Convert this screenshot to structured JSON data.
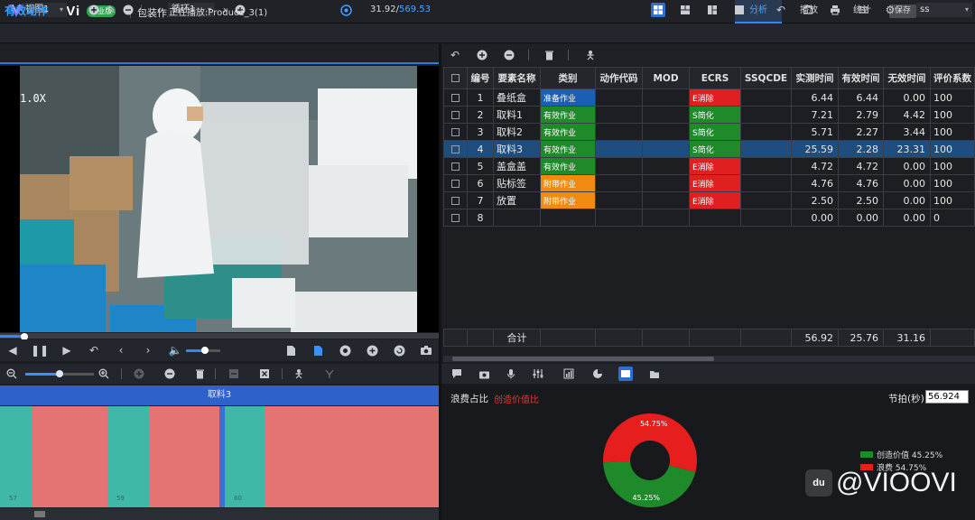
{
  "app": {
    "brand": "ViOOVi",
    "badge": "专业版",
    "project": "包装作业",
    "tabs": [
      "分析",
      "播放",
      "统计"
    ],
    "active_tab": "分析",
    "save_label": "保存"
  },
  "toolbar": {
    "view_select": "视图1",
    "loop_select": "循环1",
    "right_select": "ss"
  },
  "video": {
    "title": "有效动作",
    "status": "正在播放:Produce_3(1)",
    "current_time": "31.92/",
    "total_time": "569.53",
    "zoom": "1.0X",
    "seek_progress": 0.056,
    "volume": 0.55
  },
  "timeline": {
    "header": "取料3",
    "zoom_level": 0.5,
    "segments": [
      {
        "type": "teal",
        "label": "57"
      },
      {
        "type": "red",
        "label": ""
      },
      {
        "type": "teal",
        "label": "59"
      },
      {
        "type": "red",
        "label": ""
      },
      {
        "type": "blue",
        "label": ""
      },
      {
        "type": "teal",
        "label": "60"
      },
      {
        "type": "red",
        "label": ""
      }
    ]
  },
  "table": {
    "columns": [
      "",
      "编号",
      "要素名称",
      "类别",
      "动作代码",
      "MOD",
      "ECRS",
      "SSQCDE",
      "实测时间",
      "有效时间",
      "无效时间",
      "评价系数"
    ],
    "rows": [
      {
        "no": "1",
        "name": "叠纸盒",
        "category": "准备作业",
        "cat_color": "#1a5fb4",
        "code": "",
        "mod": "",
        "ecrs": "E消除",
        "ecrs_color": "#e02020",
        "ssqcde": "",
        "measured": "6.44",
        "effective": "6.44",
        "invalid": "0.00",
        "coef": "100",
        "selected": false
      },
      {
        "no": "2",
        "name": "取料1",
        "category": "有效作业",
        "cat_color": "#1f8a2a",
        "code": "",
        "mod": "",
        "ecrs": "S简化",
        "ecrs_color": "#1f8a2a",
        "ssqcde": "",
        "measured": "7.21",
        "effective": "2.79",
        "invalid": "4.42",
        "coef": "100",
        "selected": false
      },
      {
        "no": "3",
        "name": "取料2",
        "category": "有效作业",
        "cat_color": "#1f8a2a",
        "code": "",
        "mod": "",
        "ecrs": "S简化",
        "ecrs_color": "#1f8a2a",
        "ssqcde": "",
        "measured": "5.71",
        "effective": "2.27",
        "invalid": "3.44",
        "coef": "100",
        "selected": false
      },
      {
        "no": "4",
        "name": "取料3",
        "category": "有效作业",
        "cat_color": "#1f8a2a",
        "code": "",
        "mod": "",
        "ecrs": "S简化",
        "ecrs_color": "#1f8a2a",
        "ssqcde": "",
        "measured": "25.59",
        "effective": "2.28",
        "invalid": "23.31",
        "coef": "100",
        "selected": true
      },
      {
        "no": "5",
        "name": "盖盒盖",
        "category": "有效作业",
        "cat_color": "#1f8a2a",
        "code": "",
        "mod": "",
        "ecrs": "E消除",
        "ecrs_color": "#e02020",
        "ssqcde": "",
        "measured": "4.72",
        "effective": "4.72",
        "invalid": "0.00",
        "coef": "100",
        "selected": false
      },
      {
        "no": "6",
        "name": "贴标签",
        "category": "附带作业",
        "cat_color": "#f08a10",
        "code": "",
        "mod": "",
        "ecrs": "E消除",
        "ecrs_color": "#e02020",
        "ssqcde": "",
        "measured": "4.76",
        "effective": "4.76",
        "invalid": "0.00",
        "coef": "100",
        "selected": false
      },
      {
        "no": "7",
        "name": "放置",
        "category": "附带作业",
        "cat_color": "#f08a10",
        "code": "",
        "mod": "",
        "ecrs": "E消除",
        "ecrs_color": "#e02020",
        "ssqcde": "",
        "measured": "2.50",
        "effective": "2.50",
        "invalid": "0.00",
        "coef": "100",
        "selected": false
      },
      {
        "no": "8",
        "name": "",
        "category": "",
        "cat_color": "",
        "code": "",
        "mod": "",
        "ecrs": "",
        "ecrs_color": "",
        "ssqcde": "",
        "measured": "0.00",
        "effective": "0.00",
        "invalid": "0.00",
        "coef": "0",
        "selected": false
      }
    ],
    "total": {
      "label": "合计",
      "measured": "56.92",
      "effective": "25.76",
      "invalid": "31.16"
    }
  },
  "chart": {
    "title": "浪费占比",
    "link": "创造价值比",
    "takt_label": "节拍(秒):",
    "takt_value": "56.924",
    "legend": [
      {
        "label": "创造价值 45.25%",
        "color": "#1f8a2a"
      },
      {
        "label": "浪费 54.75%",
        "color": "#e61e1e"
      }
    ]
  },
  "chart_data": {
    "type": "pie",
    "categories": [
      "浪费",
      "创造价值"
    ],
    "values": [
      54.75,
      45.25
    ],
    "slice_labels": [
      "54.75%",
      "45.25%"
    ],
    "colors": [
      "#e61e1e",
      "#1f8a2a"
    ],
    "donut": true,
    "legend_position": "right"
  },
  "watermark": {
    "text": "@VIOOVI",
    "mark": "du"
  }
}
